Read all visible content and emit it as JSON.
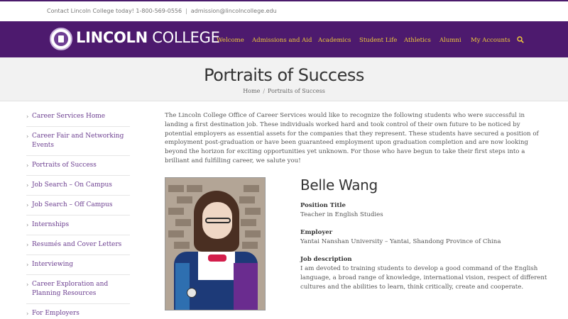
{
  "topbar": {
    "contact_text": "Contact Lincoln College today! 1-800-569-0556",
    "separator": "|",
    "email": "admission@lincolncollege.edu"
  },
  "header": {
    "brand_bold": "LINCOLN",
    "brand_light": " COLLEGE",
    "nav": [
      {
        "label": "Welcome"
      },
      {
        "label": "Admissions and Aid"
      },
      {
        "label": "Academics"
      },
      {
        "label": "Student Life"
      },
      {
        "label": "Athletics"
      },
      {
        "label": "Alumni"
      },
      {
        "label": "My Accounts"
      }
    ],
    "search_icon": "search-icon",
    "nav_color": "#f1cb3a",
    "bar_color": "#4d1a6e"
  },
  "hero": {
    "title": "Portraits of Success",
    "breadcrumb": {
      "home": "Home",
      "separator": "/",
      "current": "Portraits of Success"
    }
  },
  "sidebar": {
    "items": [
      {
        "label": "Career Services Home"
      },
      {
        "label": "Career Fair and Networking Events"
      },
      {
        "label": "Portraits of Success"
      },
      {
        "label": "Job Search – On Campus"
      },
      {
        "label": "Job Search – Off Campus"
      },
      {
        "label": "Internships"
      },
      {
        "label": "Resumés and Cover Letters"
      },
      {
        "label": "Interviewing"
      },
      {
        "label": "Career Exploration and Planning Resources"
      },
      {
        "label": "For Employers"
      }
    ],
    "chevron": "›"
  },
  "main": {
    "intro": "The Lincoln College Office of Career Services would like to recognize the following students who were successful in landing a first destination job.  These individuals worked hard and took control of their own future to be noticed by potential employers as essential assets for the companies that they represent.  These students have secured a position of employment post-graduation or have been guaranteed employment upon graduation completion and are now looking beyond the horizon for exciting opportunities yet unknown.  For those who have begun to take their first steps into a brilliant and fulfilling career, we salute you!",
    "profile": {
      "name": "Belle Wang",
      "position_label": "Position Title",
      "position_value": "Teacher in English Studies",
      "employer_label": "Employer",
      "employer_value": "Yantai Nanshan University – Yantai, Shandong Province of China",
      "description_label": "Job description",
      "description_value": "I am devoted to training students to develop a good command of the English language, a broad range of knowledge, international vision, respect of different cultures and the abilities to learn, think critically, create and cooperate."
    }
  }
}
